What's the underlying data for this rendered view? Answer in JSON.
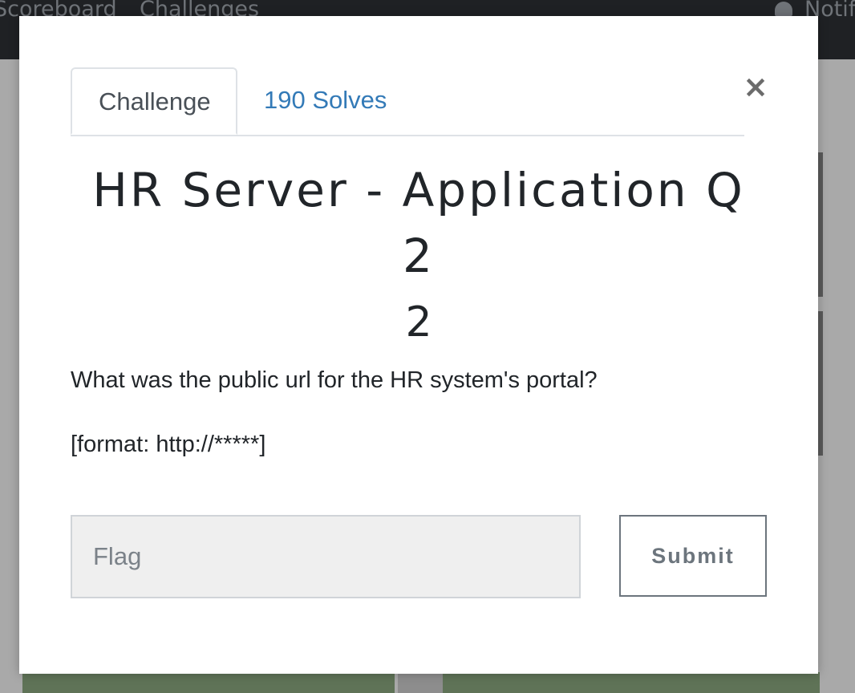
{
  "background": {
    "nav": {
      "scoreboard_label": "Scoreboard",
      "challenges_label": "Challenges",
      "notifications_label": "Notifications"
    }
  },
  "modal": {
    "tabs": [
      {
        "label": "Challenge",
        "active": true
      },
      {
        "label": "190 Solves",
        "active": false
      }
    ],
    "close_label": "×",
    "title": "HR Server - Application Q 2",
    "points": "2",
    "description": [
      "What was the public url for the HR system's portal?",
      "[format: http://*****]"
    ],
    "flag_input": {
      "placeholder": "Flag",
      "value": ""
    },
    "submit_label": "Submit"
  },
  "colors": {
    "tab_link": "#337ab7",
    "text": "#212529",
    "navbar": "#1f2124",
    "card_green": "#5f7357"
  }
}
